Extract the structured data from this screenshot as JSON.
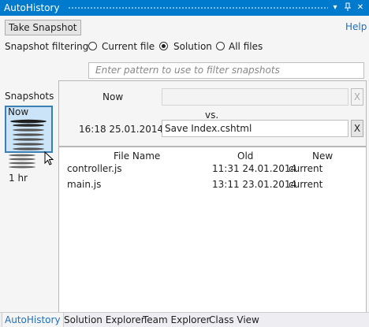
{
  "window": {
    "title": "AutoHistory",
    "dropdown_icon": "chevron-down-icon",
    "pin_icon": "pin-icon",
    "close_icon": "close-icon"
  },
  "toolbar": {
    "take_snapshot_label": "Take Snapshot",
    "help_label": "Help"
  },
  "filtering": {
    "label": "Snapshot filtering:",
    "options": [
      {
        "label": "Current file",
        "selected": false
      },
      {
        "label": "Solution",
        "selected": true
      },
      {
        "label": "All files",
        "selected": false
      }
    ],
    "pattern_placeholder": "Enter pattern to use to filter snapshots"
  },
  "snapshots": {
    "label": "Snapshots",
    "now_label": "Now",
    "bottom_label": "1 hr"
  },
  "compare": {
    "left_label": "Now",
    "left_value": "",
    "vs_label": "vs.",
    "right_label": "16:18 25.01.2014",
    "right_value": "Save Index.cshtml",
    "clear_label": "X"
  },
  "files": {
    "headers": [
      "File Name",
      "Old",
      "New"
    ],
    "rows": [
      {
        "name": "controller.js",
        "old": "11:31 24.01.2014",
        "new": "current"
      },
      {
        "name": "main.js",
        "old": "13:11 23.01.2014",
        "new": "current"
      }
    ]
  },
  "bottom_tabs": [
    "AutoHistory",
    "Solution Explorer",
    "Team Explorer",
    "Class View"
  ],
  "colors": {
    "accent": "#007acc",
    "link": "#1e6fbf",
    "selection": "#cce4f7"
  }
}
